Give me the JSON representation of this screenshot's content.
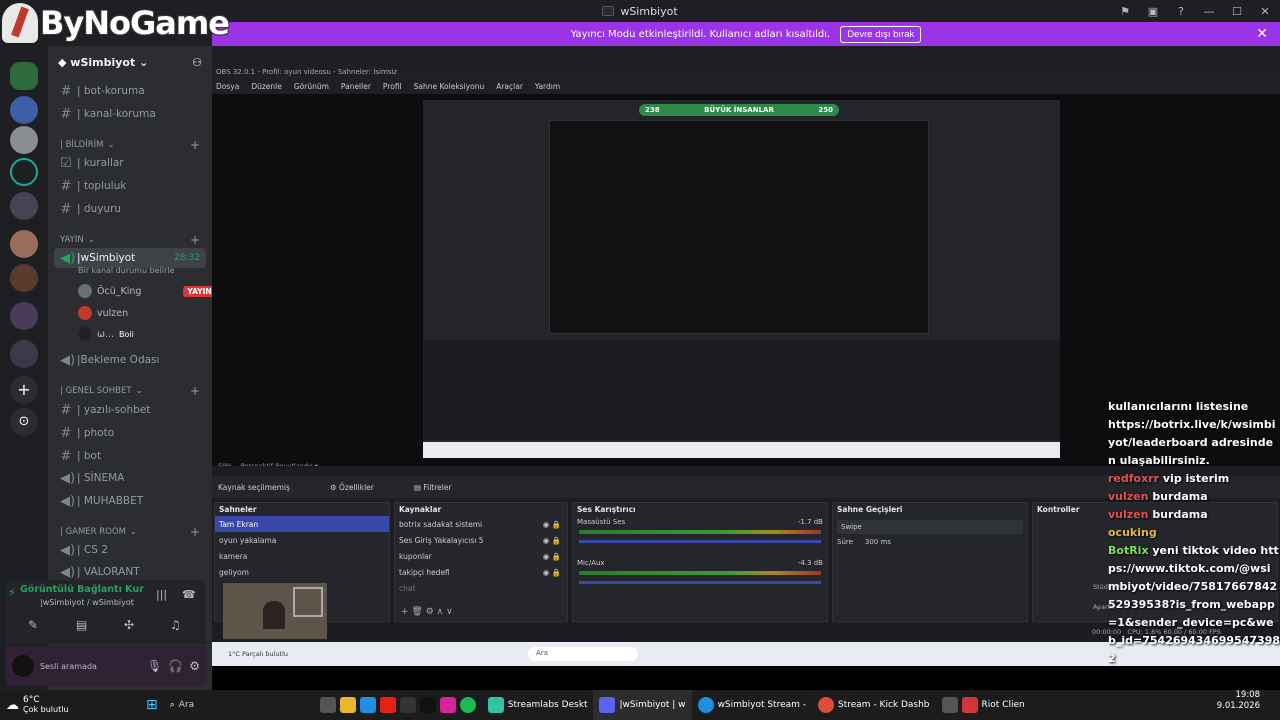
{
  "logo": {
    "text": "ByNoGame"
  },
  "window": {
    "title": "wSimbiyot"
  },
  "banner": {
    "message": "Yayıncı Modu etkinleştirildi. Kullanıcı adları kısaltıldı.",
    "button": "Devre dışı bırak"
  },
  "server": {
    "name": "wSimbiyot"
  },
  "channels": {
    "bot_koruma": "| bot-koruma",
    "kanal_koruma": "| kanal-koruma",
    "cat_bildirim": "| BİLDİRİM",
    "kurallar": "| kurallar",
    "topluluk": "| topluluk",
    "duyuru": "| duyuru",
    "cat_yayin": "Yayın",
    "voice_wsimbiyot": "|wSimbiyot",
    "voice_time": "28:32",
    "voice_status": "Bir kanal durumu belirle",
    "user1": "Öcü_King",
    "user1_badge": "YAYINDA",
    "user2": "vulzen",
    "user3": "ω...",
    "user3_status": "Boii",
    "bekleme": "|Bekleme Odası",
    "cat_genel": "| GENEL SOHBET",
    "yazili": "| yazılı-sohbet",
    "photo": "| photo",
    "bot": "| bot",
    "sinema": "| SİNEMA",
    "muhabbet": "| MUHABBET",
    "cat_gamer": "| Gamer Room",
    "cs2": "| CS 2",
    "valorant": "| VALORANT"
  },
  "voice_panel": {
    "status": "Görüntülü Bağlantı Kur",
    "channel": "|wSimbiyot / wSimbiyot"
  },
  "user_panel": {
    "status": "Sesli aramada"
  },
  "obs": {
    "title": "OBS 32.0.1 - Profil: oyun videosu - Sahneler: İsimsiz",
    "menu": [
      "Dosya",
      "Düzenle",
      "Görünüm",
      "Paneller",
      "Profil",
      "Sahne Koleksiyonu",
      "Araçlar",
      "Yardım"
    ],
    "zoom": "59%",
    "view_mode": "Perspektif Boyutlandır",
    "no_source": "Kaynak seçilmemiş",
    "properties": "Özellikler",
    "filters": "Filtreler",
    "scenes_title": "Sahneler",
    "scenes": [
      "Tam Ekran",
      "oyun yakalama",
      "kamera",
      "geliyom"
    ],
    "sources_title": "Kaynaklar",
    "sources": [
      "botrix sadakat sistemi",
      "Ses Giriş Yakalayıcısı 5",
      "kuponlar",
      "takipçi hedefi",
      "chat"
    ],
    "mixer_title": "Ses Karıştırıcı",
    "mixer1": "Masaüstü Ses",
    "mixer1_db": "-1.7 dB",
    "mixer2": "Mic/Aux",
    "mixer2_db": "-4.3 dB",
    "transitions_title": "Sahne Geçişleri",
    "transition": "Swipe",
    "duration_label": "Süre",
    "duration": "300 ms",
    "controls_title": "Kontroller",
    "stats": "CPU: 1.6%   60.00 / 60.00 FPS",
    "timer": "00:00:00",
    "studio": "Stüdyo M",
    "settings": "Ayarlar",
    "preview_banner": "BÜYÜK İNSANLAR",
    "preview_left": "238",
    "preview_right": "250"
  },
  "obs_taskbar": {
    "weather": "1°C",
    "weather_sub": "Parçalı bulutlu",
    "search": "Ara"
  },
  "chat": [
    {
      "name": "",
      "text": "kullanıcılarını listesine"
    },
    {
      "name": "",
      "text": "https://botrix.live/k/wsimbiyot/leaderboard adresinden ulaşabilirsiniz."
    },
    {
      "name": "redfoxrr",
      "text": "vip isterim"
    },
    {
      "name": "vulzen",
      "text": "burdama"
    },
    {
      "name": "vulzen",
      "text": "burdama"
    },
    {
      "name": "ocuking",
      "text": ""
    },
    {
      "name": "BotRix",
      "text": "yeni tiktok video https://www.tiktok.com/@wsimbiyot/video/7581766784252939538?is_from_webapp=1&sender_device=pc&web_id=7542694346995473982"
    }
  ],
  "taskbar": {
    "weather_temp": "6°C",
    "weather_desc": "Çok bulutlu",
    "search": "Ara",
    "apps": [
      "Streamlabs Deskt",
      "|wSimbiyot | w",
      "wSimbiyot Stream -",
      "Stream - Kick Dashb",
      "Riot Clien"
    ],
    "time": "19:08",
    "date": "9.01.2026"
  },
  "colors": {
    "banner": "#9b33e6",
    "discord_bg": "#2b2d31",
    "live_badge": "#da373c",
    "obs_selected": "#3847a8"
  }
}
